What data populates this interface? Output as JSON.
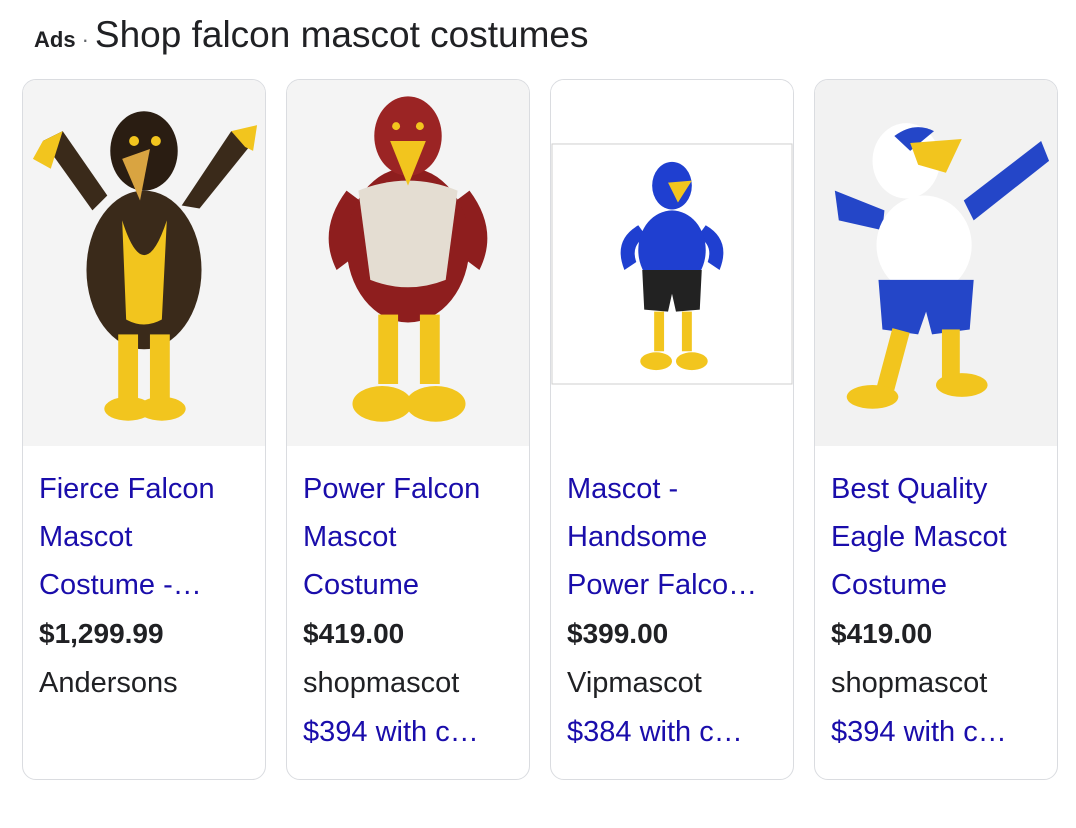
{
  "header": {
    "ads_label": "Ads",
    "separator": "·",
    "title": "Shop falcon mascot costumes"
  },
  "products": [
    {
      "title_lines": [
        "Fierce Falcon",
        "Mascot",
        "Costume -…"
      ],
      "price": "$1,299.99",
      "merchant": "Andersons",
      "promo": ""
    },
    {
      "title_lines": [
        "Power Falcon",
        "Mascot",
        "Costume"
      ],
      "price": "$419.00",
      "merchant": "shopmascot",
      "promo": "$394 with c…"
    },
    {
      "title_lines": [
        "Mascot -",
        "Handsome",
        "Power Falco…"
      ],
      "price": "$399.00",
      "merchant": "Vipmascot",
      "promo": "$384 with c…"
    },
    {
      "title_lines": [
        "Best Quality",
        "Eagle Mascot",
        "Costume"
      ],
      "price": "$419.00",
      "merchant": "shopmascot",
      "promo": "$394 with c…"
    }
  ],
  "colors": {
    "link": "#1a0dab",
    "text": "#202124",
    "card_border": "#dadce0"
  }
}
